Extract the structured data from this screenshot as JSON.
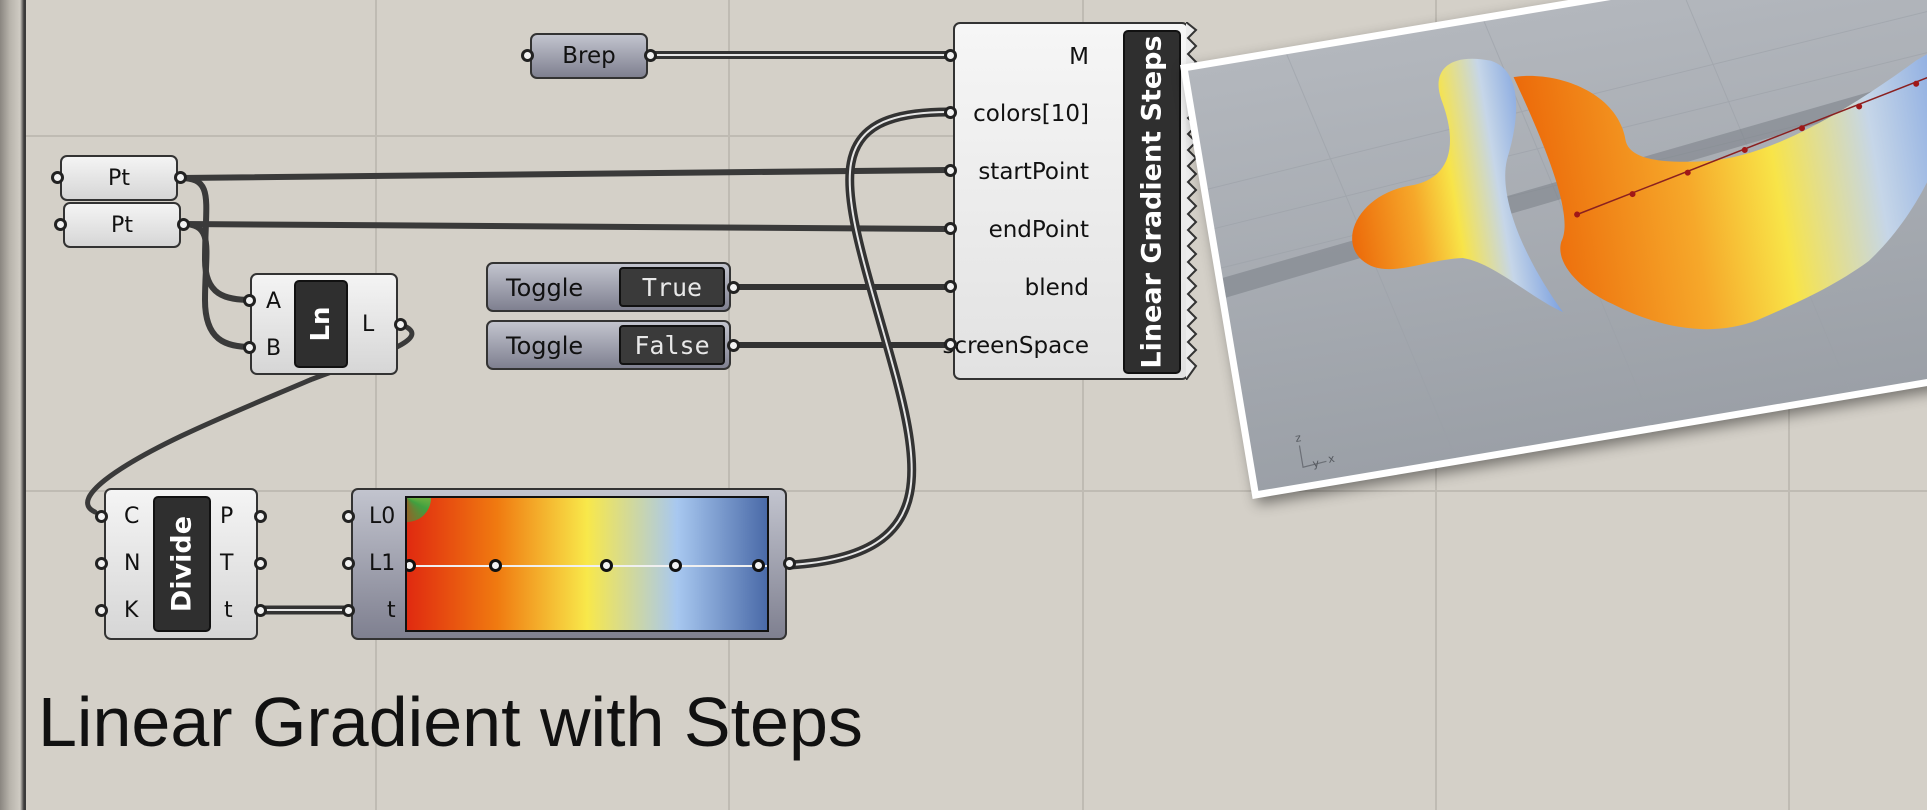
{
  "title": "Linear Gradient with Steps",
  "components": {
    "brep": {
      "label": "Brep"
    },
    "pt1": {
      "label": "Pt"
    },
    "pt2": {
      "label": "Pt"
    },
    "line": {
      "name": "Ln",
      "inputs": [
        "A",
        "B"
      ],
      "outputs": [
        "L"
      ]
    },
    "toggle_blend": {
      "label": "Toggle",
      "value": "True"
    },
    "toggle_screen": {
      "label": "Toggle",
      "value": "False"
    },
    "divide": {
      "name": "Divide",
      "inputs": [
        "C",
        "N",
        "K"
      ],
      "outputs": [
        "P",
        "T",
        "t"
      ]
    },
    "gradient": {
      "inputs": [
        "L0",
        "L1",
        "t"
      ],
      "stops": [
        "#e02a10",
        "#f07a10",
        "#f8e84a",
        "#a8c8f0",
        "#4a6aa8"
      ]
    },
    "main": {
      "name": "Linear Gradient Steps",
      "inputs": [
        "M",
        "colors[10]",
        "startPoint",
        "endPoint",
        "blend",
        "screenSpace"
      ]
    }
  },
  "viewport": {
    "axes": {
      "z": "z",
      "y": "y",
      "x": "x"
    },
    "colors": {
      "orange": "#f08a10",
      "yellow": "#f8e040",
      "blue": "#8ab0e8",
      "background": "#a6abb2"
    }
  },
  "colors": {
    "canvas": "#d4d0c8",
    "grid": "#bfbbb3",
    "wire": "#3a3a3a"
  }
}
